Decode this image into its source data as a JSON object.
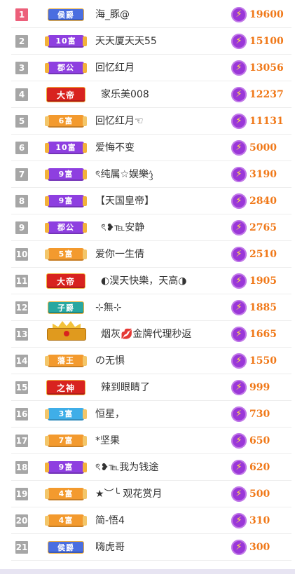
{
  "leaderboard": {
    "rows": [
      {
        "rank": "1",
        "badge": "侯爵",
        "badge_style": "blue",
        "name": "海_豚@",
        "score": "19600"
      },
      {
        "rank": "2",
        "badge": "10富",
        "badge_style": "purple",
        "name": "天天厦天天55",
        "score": "15100"
      },
      {
        "rank": "3",
        "badge": "郡公",
        "badge_style": "purple",
        "name": "回忆红月",
        "score": "13056"
      },
      {
        "rank": "4",
        "badge": "大帝",
        "badge_style": "grand",
        "name": "家乐美008",
        "score": "12237"
      },
      {
        "rank": "5",
        "badge": "6富",
        "badge_style": "orange",
        "name": "回忆红月☜",
        "score": "11131"
      },
      {
        "rank": "6",
        "badge": "10富",
        "badge_style": "purple",
        "name": "爱悔不变",
        "score": "5000"
      },
      {
        "rank": "7",
        "badge": "9富",
        "badge_style": "purple",
        "name": "ৎ纯属☆娱樂ᦤ",
        "score": "3190"
      },
      {
        "rank": "8",
        "badge": "9富",
        "badge_style": "purple",
        "name": "【天国皇帝】",
        "score": "2840"
      },
      {
        "rank": "9",
        "badge": "郡公",
        "badge_style": "purple",
        "name": "ৎ❥℡安静",
        "score": "2765"
      },
      {
        "rank": "10",
        "badge": "5富",
        "badge_style": "orange",
        "name": "爱你一生倩",
        "score": "2510"
      },
      {
        "rank": "11",
        "badge": "大帝",
        "badge_style": "grand",
        "name": "◐淏天快樂，天高◑",
        "score": "1905"
      },
      {
        "rank": "12",
        "badge": "子爵",
        "badge_style": "teal",
        "name": "⊹無⊹",
        "score": "1885"
      },
      {
        "rank": "13",
        "badge": "",
        "badge_style": "crown",
        "name": "烟灰💋金牌代理秒返",
        "score": "1665"
      },
      {
        "rank": "14",
        "badge": "藩王",
        "badge_style": "orange",
        "name": "の无惧",
        "score": "1550"
      },
      {
        "rank": "15",
        "badge": "之神",
        "badge_style": "grand",
        "name": "辣到眼睛了",
        "score": "999"
      },
      {
        "rank": "16",
        "badge": "3富",
        "badge_style": "cyan",
        "name": "恒星，",
        "score": "730"
      },
      {
        "rank": "17",
        "badge": "7富",
        "badge_style": "orange",
        "name": "*坚果",
        "score": "650"
      },
      {
        "rank": "18",
        "badge": "9富",
        "badge_style": "purple",
        "name": "ৎ❥℡我为钱途",
        "score": "620"
      },
      {
        "rank": "19",
        "badge": "4富",
        "badge_style": "orange",
        "name": "★︶╰ 观花赏月",
        "score": "500"
      },
      {
        "rank": "20",
        "badge": "4富",
        "badge_style": "orange",
        "name": "简-悟4",
        "score": "310"
      },
      {
        "rank": "21",
        "badge": "侯爵",
        "badge_style": "blue",
        "name": "嗨虎哥",
        "score": "300"
      }
    ],
    "score_icon": "lightning-coin-icon",
    "icon_glyph": "⚡"
  },
  "colors": {
    "rank_top": "#ec5f7a",
    "rank_default": "#a6a6a6",
    "score": "#f07818",
    "coin": "#9a37d8"
  }
}
